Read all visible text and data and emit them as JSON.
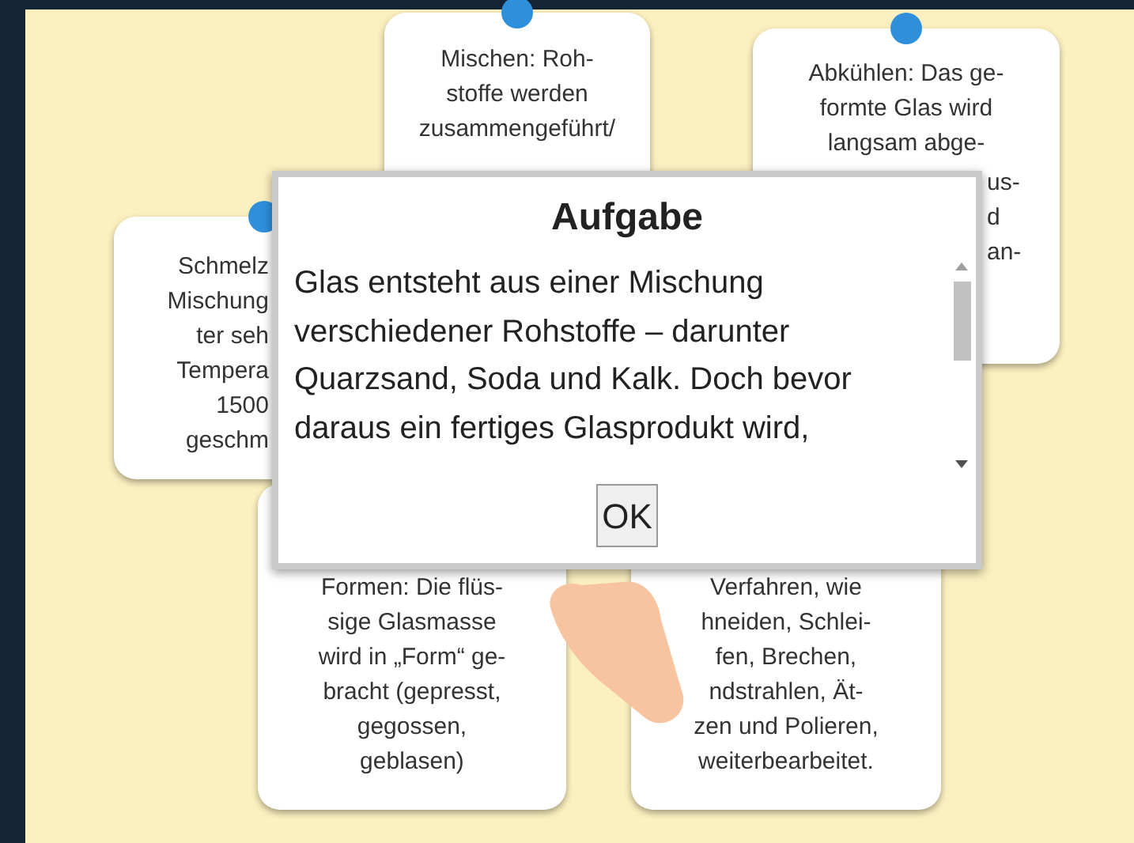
{
  "cards": [
    {
      "dot": true,
      "lines": [
        "Mischen: Roh-",
        "stoffe werden",
        "zusammengeführt/"
      ]
    },
    {
      "dot": true,
      "lines": [
        "Abkühlen: Das ge-",
        "formte Glas wird",
        "langsam abge-"
      ],
      "fragments": [
        "us-",
        "d",
        "an-"
      ]
    },
    {
      "dot": true,
      "lines": [
        "Schmelz",
        "Mischung",
        "ter seh",
        "Tempera",
        "1500",
        "geschm"
      ]
    },
    {
      "dot": false,
      "lines": [
        "Formen: Die flüs-",
        "sige Glasmasse",
        "wird in „Form“ ge-",
        "bracht (gepresst,",
        "gegossen,",
        "geblasen)"
      ]
    },
    {
      "dot": false,
      "lines": [
        "Verfahren, wie",
        "hneiden, Schlei-",
        "fen, Brechen,",
        "ndstrahlen, Ät-",
        "zen und Polieren,",
        "weiterbearbeitet."
      ]
    }
  ],
  "dialog": {
    "title": "Aufgabe",
    "text": "Glas entsteht aus einer Mischung verschiedener Rohstoffe – darunter Quarzsand, Soda und Kalk. Doch bevor daraus ein fertiges Glasprodukt wird,",
    "button": "OK"
  }
}
